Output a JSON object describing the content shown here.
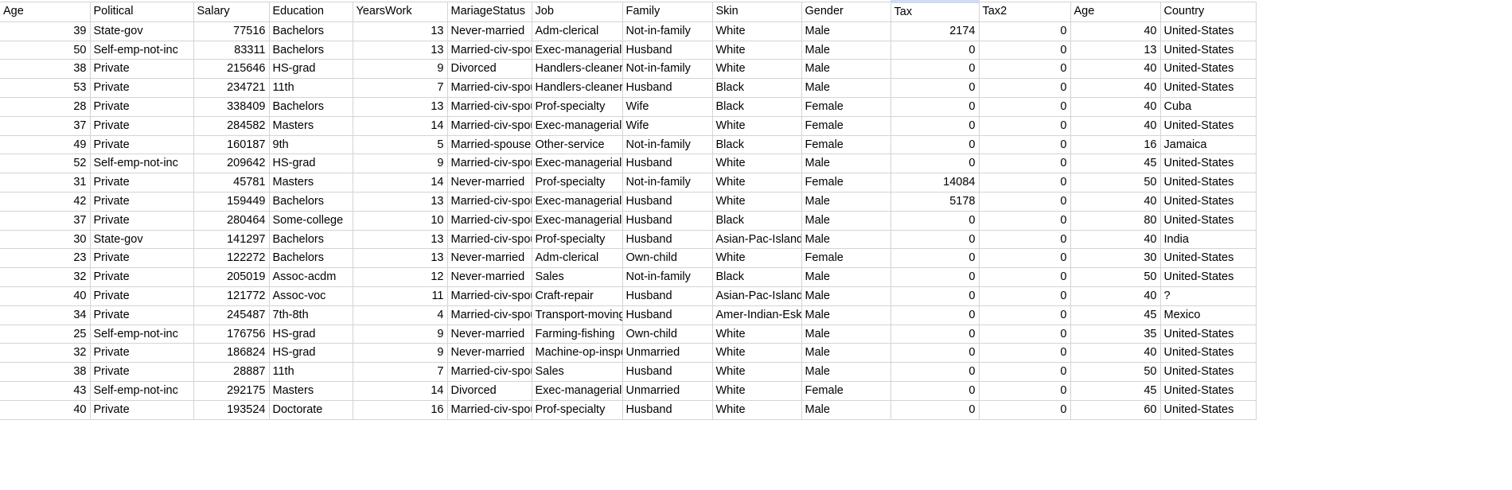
{
  "sheet": {
    "selected_column": "Tax",
    "grid_line_color": "#d4d4d4",
    "background_color": "#ffffff",
    "text_color": "#000000",
    "selection_color": "#cfdcf2",
    "row_count": 21,
    "column_count": 14
  },
  "table": {
    "columns": [
      {
        "label": "Age",
        "align": "num",
        "key": "c-age",
        "selected": false
      },
      {
        "label": "Political",
        "align": "txt",
        "key": "c-pol",
        "selected": false
      },
      {
        "label": "Salary",
        "align": "num",
        "key": "c-sal",
        "selected": false
      },
      {
        "label": "Education",
        "align": "txt",
        "key": "c-edu",
        "selected": false
      },
      {
        "label": "YearsWork",
        "align": "num",
        "key": "c-yw",
        "selected": false
      },
      {
        "label": "MariageStatus",
        "align": "txt",
        "key": "c-mar",
        "selected": false
      },
      {
        "label": "Job",
        "align": "txt",
        "key": "c-job",
        "selected": false
      },
      {
        "label": "Family",
        "align": "txt",
        "key": "c-fam",
        "selected": false
      },
      {
        "label": "Skin",
        "align": "txt",
        "key": "c-skin",
        "selected": false
      },
      {
        "label": "Gender",
        "align": "txt",
        "key": "c-gen",
        "selected": false
      },
      {
        "label": "Tax",
        "align": "num",
        "key": "c-tax",
        "selected": true
      },
      {
        "label": "Tax2",
        "align": "num",
        "key": "c-tax2",
        "selected": false
      },
      {
        "label": "Age",
        "align": "num",
        "key": "c-age2",
        "selected": false
      },
      {
        "label": "Country",
        "align": "txt",
        "key": "c-country",
        "selected": false
      }
    ],
    "rows": [
      [
        "39",
        "State-gov",
        "77516",
        "Bachelors",
        "13",
        "Never-married",
        "Adm-clerical",
        "Not-in-family",
        "White",
        "Male",
        "2174",
        "0",
        "40",
        "United-States"
      ],
      [
        "50",
        "Self-emp-not-inc",
        "83311",
        "Bachelors",
        "13",
        "Married-civ-spouse",
        "Exec-managerial",
        "Husband",
        "White",
        "Male",
        "0",
        "0",
        "13",
        "United-States"
      ],
      [
        "38",
        "Private",
        "215646",
        "HS-grad",
        "9",
        "Divorced",
        "Handlers-cleaners",
        "Not-in-family",
        "White",
        "Male",
        "0",
        "0",
        "40",
        "United-States"
      ],
      [
        "53",
        "Private",
        "234721",
        "11th",
        "7",
        "Married-civ-spouse",
        "Handlers-cleaners",
        "Husband",
        "Black",
        "Male",
        "0",
        "0",
        "40",
        "United-States"
      ],
      [
        "28",
        "Private",
        "338409",
        "Bachelors",
        "13",
        "Married-civ-spouse",
        "Prof-specialty",
        "Wife",
        "Black",
        "Female",
        "0",
        "0",
        "40",
        "Cuba"
      ],
      [
        "37",
        "Private",
        "284582",
        "Masters",
        "14",
        "Married-civ-spouse",
        "Exec-managerial",
        "Wife",
        "White",
        "Female",
        "0",
        "0",
        "40",
        "United-States"
      ],
      [
        "49",
        "Private",
        "160187",
        "9th",
        "5",
        "Married-spouse-absent",
        "Other-service",
        "Not-in-family",
        "Black",
        "Female",
        "0",
        "0",
        "16",
        "Jamaica"
      ],
      [
        "52",
        "Self-emp-not-inc",
        "209642",
        "HS-grad",
        "9",
        "Married-civ-spouse",
        "Exec-managerial",
        "Husband",
        "White",
        "Male",
        "0",
        "0",
        "45",
        "United-States"
      ],
      [
        "31",
        "Private",
        "45781",
        "Masters",
        "14",
        "Never-married",
        "Prof-specialty",
        "Not-in-family",
        "White",
        "Female",
        "14084",
        "0",
        "50",
        "United-States"
      ],
      [
        "42",
        "Private",
        "159449",
        "Bachelors",
        "13",
        "Married-civ-spouse",
        "Exec-managerial",
        "Husband",
        "White",
        "Male",
        "5178",
        "0",
        "40",
        "United-States"
      ],
      [
        "37",
        "Private",
        "280464",
        "Some-college",
        "10",
        "Married-civ-spouse",
        "Exec-managerial",
        "Husband",
        "Black",
        "Male",
        "0",
        "0",
        "80",
        "United-States"
      ],
      [
        "30",
        "State-gov",
        "141297",
        "Bachelors",
        "13",
        "Married-civ-spouse",
        "Prof-specialty",
        "Husband",
        "Asian-Pac-Islander",
        "Male",
        "0",
        "0",
        "40",
        "India"
      ],
      [
        "23",
        "Private",
        "122272",
        "Bachelors",
        "13",
        "Never-married",
        "Adm-clerical",
        "Own-child",
        "White",
        "Female",
        "0",
        "0",
        "30",
        "United-States"
      ],
      [
        "32",
        "Private",
        "205019",
        "Assoc-acdm",
        "12",
        "Never-married",
        "Sales",
        "Not-in-family",
        "Black",
        "Male",
        "0",
        "0",
        "50",
        "United-States"
      ],
      [
        "40",
        "Private",
        "121772",
        "Assoc-voc",
        "11",
        "Married-civ-spouse",
        "Craft-repair",
        "Husband",
        "Asian-Pac-Islander",
        "Male",
        "0",
        "0",
        "40",
        "?"
      ],
      [
        "34",
        "Private",
        "245487",
        "7th-8th",
        "4",
        "Married-civ-spouse",
        "Transport-moving",
        "Husband",
        "Amer-Indian-Eskimo",
        "Male",
        "0",
        "0",
        "45",
        "Mexico"
      ],
      [
        "25",
        "Self-emp-not-inc",
        "176756",
        "HS-grad",
        "9",
        "Never-married",
        "Farming-fishing",
        "Own-child",
        "White",
        "Male",
        "0",
        "0",
        "35",
        "United-States"
      ],
      [
        "32",
        "Private",
        "186824",
        "HS-grad",
        "9",
        "Never-married",
        "Machine-op-inspct",
        "Unmarried",
        "White",
        "Male",
        "0",
        "0",
        "40",
        "United-States"
      ],
      [
        "38",
        "Private",
        "28887",
        "11th",
        "7",
        "Married-civ-spouse",
        "Sales",
        "Husband",
        "White",
        "Male",
        "0",
        "0",
        "50",
        "United-States"
      ],
      [
        "43",
        "Self-emp-not-inc",
        "292175",
        "Masters",
        "14",
        "Divorced",
        "Exec-managerial",
        "Unmarried",
        "White",
        "Female",
        "0",
        "0",
        "45",
        "United-States"
      ],
      [
        "40",
        "Private",
        "193524",
        "Doctorate",
        "16",
        "Married-civ-spouse",
        "Prof-specialty",
        "Husband",
        "White",
        "Male",
        "0",
        "0",
        "60",
        "United-States"
      ]
    ]
  }
}
